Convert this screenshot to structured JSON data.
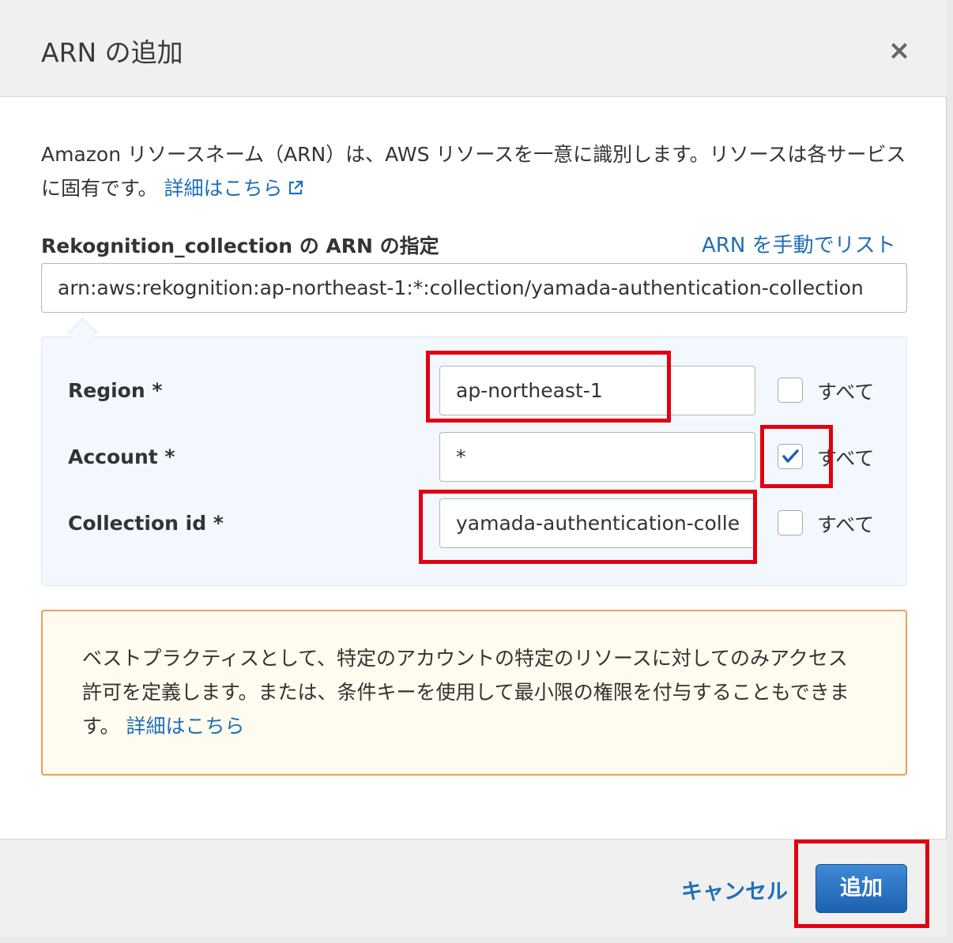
{
  "dialog": {
    "title": "ARN の追加",
    "close_label": "×",
    "description": "Amazon リソースネーム（ARN）は、AWS リソースを一意に識別します。リソースは各サービスに固有です。",
    "learn_more": "詳細はこちら",
    "spec_label": "Rekognition_collection の ARN の指定",
    "manual_list_link": "ARN を手動でリスト",
    "arn_value": "arn:aws:rekognition:ap-northeast-1:*:collection/yamada-authentication-collection"
  },
  "fields": [
    {
      "label": "Region *",
      "value": "ap-northeast-1",
      "all_label": "すべて",
      "all_checked": false
    },
    {
      "label": "Account *",
      "value": "*",
      "all_label": "すべて",
      "all_checked": true
    },
    {
      "label": "Collection id *",
      "value": "yamada-authentication-colle",
      "all_label": "すべて",
      "all_checked": false
    }
  ],
  "note": {
    "text": "ベストプラクティスとして、特定のアカウントの特定のリソースに対してのみアクセス許可を定義します。または、条件キーを使用して最小限の権限を付与することもできます。",
    "link": "詳細はこちら"
  },
  "footer": {
    "cancel": "キャンセル",
    "add": "追加"
  },
  "colors": {
    "link": "#1f6fb8",
    "primary_button": "#2a72c4",
    "highlight": "#e00010",
    "note_border": "#e9a057",
    "note_background": "#fffbee"
  }
}
